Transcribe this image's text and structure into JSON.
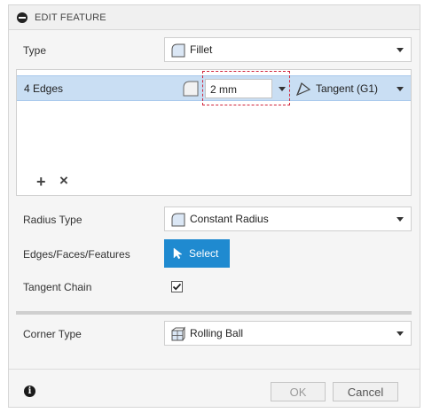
{
  "dialog": {
    "title": "EDIT FEATURE"
  },
  "type": {
    "label": "Type",
    "value": "Fillet",
    "icon": "fillet-icon"
  },
  "edges": {
    "label": "4 Edges",
    "radius_value": "2 mm",
    "continuity": "Tangent (G1)",
    "add_symbol": "+",
    "remove_symbol": "×"
  },
  "radius_type": {
    "label": "Radius Type",
    "value": "Constant Radius"
  },
  "selection": {
    "label": "Edges/Faces/Features",
    "button_label": "Select"
  },
  "tangent_chain": {
    "label": "Tangent Chain",
    "checked": true
  },
  "corner_type": {
    "label": "Corner Type",
    "value": "Rolling Ball"
  },
  "footer": {
    "ok_label": "OK",
    "cancel_label": "Cancel",
    "info_symbol": "i"
  },
  "colors": {
    "accent": "#1f8ad0",
    "selected_row": "#c9def3",
    "highlight_dash": "#d0243a"
  }
}
